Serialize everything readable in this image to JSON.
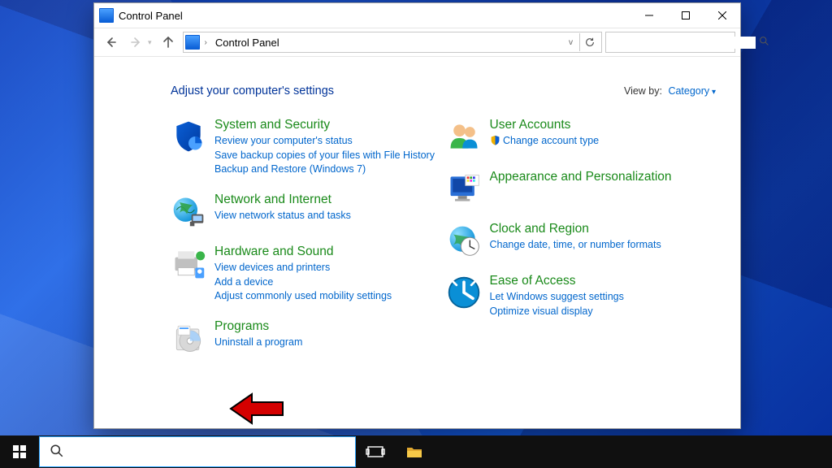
{
  "window": {
    "title": "Control Panel",
    "breadcrumb": "Control Panel"
  },
  "search": {
    "placeholder": ""
  },
  "header": {
    "settings_heading": "Adjust your computer's settings",
    "view_by_label": "View by:",
    "view_by_value": "Category"
  },
  "left_categories": [
    {
      "title": "System and Security",
      "icon": "shield-icon",
      "links": [
        "Review your computer's status",
        "Save backup copies of your files with File History",
        "Backup and Restore (Windows 7)"
      ]
    },
    {
      "title": "Network and Internet",
      "icon": "globe-icon",
      "links": [
        "View network status and tasks"
      ]
    },
    {
      "title": "Hardware and Sound",
      "icon": "printer-icon",
      "links": [
        "View devices and printers",
        "Add a device",
        "Adjust commonly used mobility settings"
      ]
    },
    {
      "title": "Programs",
      "icon": "disc-icon",
      "links": [
        "Uninstall a program"
      ]
    }
  ],
  "right_categories": [
    {
      "title": "User Accounts",
      "icon": "people-icon",
      "links": [
        "Change account type"
      ],
      "link_icons": [
        "shield-badge-icon"
      ]
    },
    {
      "title": "Appearance and Personalization",
      "icon": "personalization-icon",
      "links": []
    },
    {
      "title": "Clock and Region",
      "icon": "clock-icon",
      "links": [
        "Change date, time, or number formats"
      ]
    },
    {
      "title": "Ease of Access",
      "icon": "access-icon",
      "links": [
        "Let Windows suggest settings",
        "Optimize visual display"
      ]
    }
  ]
}
